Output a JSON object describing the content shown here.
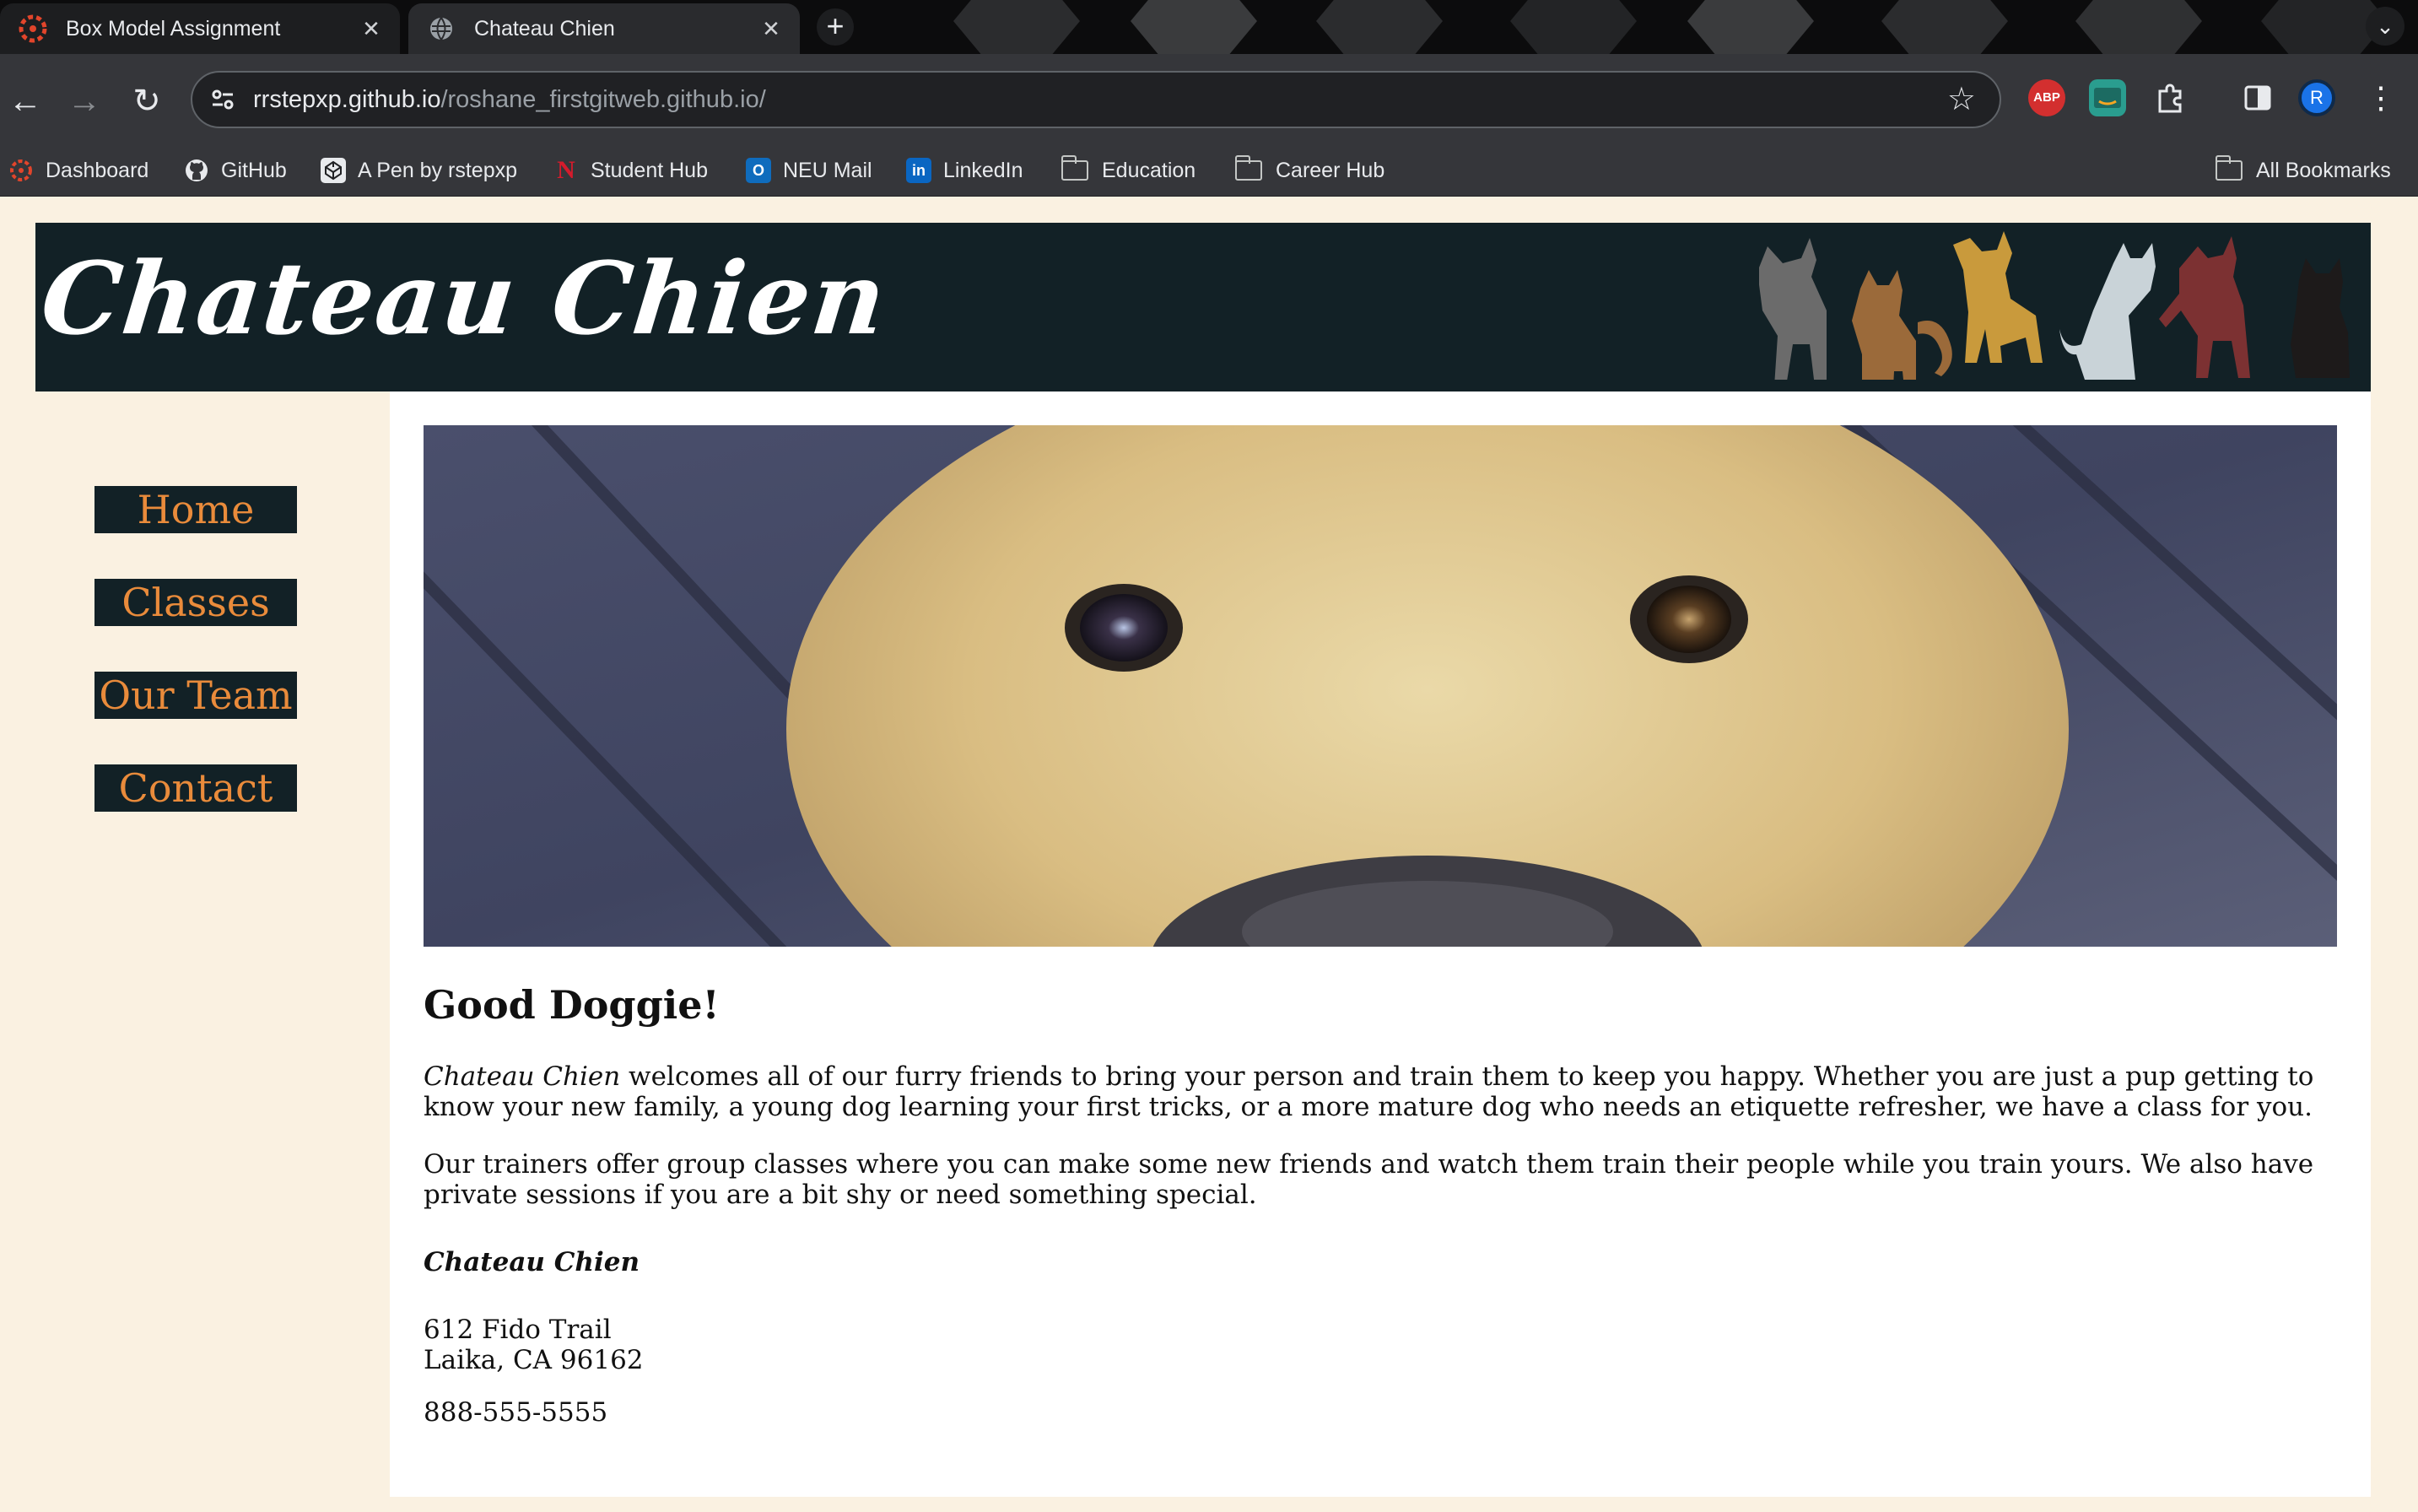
{
  "browser": {
    "tabs": [
      {
        "title": "Box Model Assignment",
        "active": false,
        "favicon": "canvas-icon"
      },
      {
        "title": "Chateau Chien",
        "active": true,
        "favicon": "globe-icon"
      }
    ],
    "close_glyph": "✕",
    "new_tab_glyph": "+",
    "tab_menu_glyph": "⌄",
    "url_host": "rrstepxp.github.io",
    "url_path": "/roshane_firstgitweb.github.io/",
    "nav": {
      "back": "←",
      "forward": "→",
      "reload": "↻"
    },
    "star_glyph": "☆",
    "extensions": [
      {
        "name": "adblock-plus-icon",
        "label": "ABP",
        "color": "#d32f2f"
      },
      {
        "name": "amazon-assistant-icon",
        "label": "",
        "color": "#2a9d8f"
      }
    ],
    "profile_initial": "R",
    "menu_glyph": "⋮"
  },
  "bookmarks": {
    "items": [
      {
        "label": "Dashboard",
        "icon": "canvas-icon"
      },
      {
        "label": "GitHub",
        "icon": "github-icon"
      },
      {
        "label": "A Pen by rstepxp",
        "icon": "codepen-icon"
      },
      {
        "label": "Student Hub",
        "icon": "northeastern-icon"
      },
      {
        "label": "NEU Mail",
        "icon": "outlook-icon"
      },
      {
        "label": "LinkedIn",
        "icon": "linkedin-icon"
      },
      {
        "label": "Education",
        "icon": "folder-icon"
      },
      {
        "label": "Career Hub",
        "icon": "folder-icon"
      }
    ],
    "all_bookmarks": "All Bookmarks"
  },
  "site": {
    "logo": "Chateau Chien",
    "nav": [
      "Home",
      "Classes",
      "Our Team",
      "Contact"
    ],
    "heading": "Good Doggie!",
    "intro_em": "Chateau Chien",
    "intro_rest": " welcomes all of our furry friends to bring your person and train them to keep you happy. Whether you are just a pup getting to know your new family, a young dog learning your first tricks, or a more mature dog who needs an etiquette refresher, we have a class for you.",
    "paragraph2": "Our trainers offer group classes where you can make some new friends and watch them train their people while you train yours. We also have private sessions if you are a bit shy or need something special.",
    "signature": "Chateau Chien",
    "address_line1": "612 Fido Trail",
    "address_line2": "Laika, CA 96162",
    "phone": "888-555-5555"
  },
  "colors": {
    "page_bg": "#faf1e1",
    "header_bg": "#122126",
    "nav_text": "#e98b3b",
    "pet_silhouettes": [
      "#6b6b6b",
      "#9b6a3a",
      "#c99a3c",
      "#c9d3d8",
      "#7c3132",
      "#1d1a1a"
    ]
  }
}
